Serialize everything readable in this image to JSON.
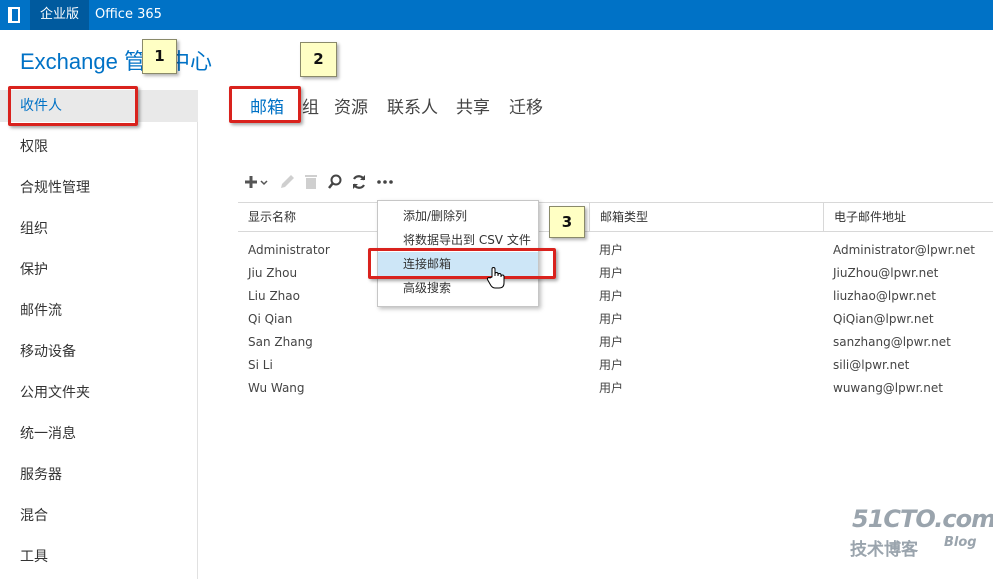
{
  "topbar": {
    "tab_active": "企业版",
    "tab_office": "Office 365"
  },
  "title": "Exchange 管理中心",
  "sidebar": {
    "items": [
      "收件人",
      "权限",
      "合规性管理",
      "组织",
      "保护",
      "邮件流",
      "移动设备",
      "公用文件夹",
      "统一消息",
      "服务器",
      "混合",
      "工具"
    ]
  },
  "tabs": [
    "邮箱",
    "组",
    "资源",
    "联系人",
    "共享",
    "迁移"
  ],
  "toolbar": {
    "add_icon": "plus-icon",
    "edit_icon": "pencil-icon",
    "delete_icon": "trash-icon",
    "search_icon": "search-icon",
    "refresh_icon": "refresh-icon",
    "more_icon": "ellipsis-icon"
  },
  "table": {
    "columns": [
      "显示名称",
      "邮箱类型",
      "电子邮件地址"
    ],
    "rows": [
      [
        "Administrator",
        "用户",
        "Administrator@lpwr.net"
      ],
      [
        "Jiu Zhou",
        "用户",
        "JiuZhou@lpwr.net"
      ],
      [
        "Liu Zhao",
        "用户",
        "liuzhao@lpwr.net"
      ],
      [
        "Qi Qian",
        "用户",
        "QiQian@lpwr.net"
      ],
      [
        "San Zhang",
        "用户",
        "sanzhang@lpwr.net"
      ],
      [
        "Si Li",
        "用户",
        "sili@lpwr.net"
      ],
      [
        "Wu Wang",
        "用户",
        "wuwang@lpwr.net"
      ]
    ]
  },
  "menu": {
    "items": [
      "添加/删除列",
      "将数据导出到 CSV 文件",
      "连接邮箱",
      "高级搜索"
    ]
  },
  "callouts": [
    "1",
    "2",
    "3"
  ],
  "watermark": {
    "big": "51CTO.com",
    "small": "技术博客",
    "blog": "Blog"
  },
  "colors": {
    "brand": "#0072c6",
    "highlight": "#d9221d",
    "callout_bg": "#ffffc4"
  }
}
